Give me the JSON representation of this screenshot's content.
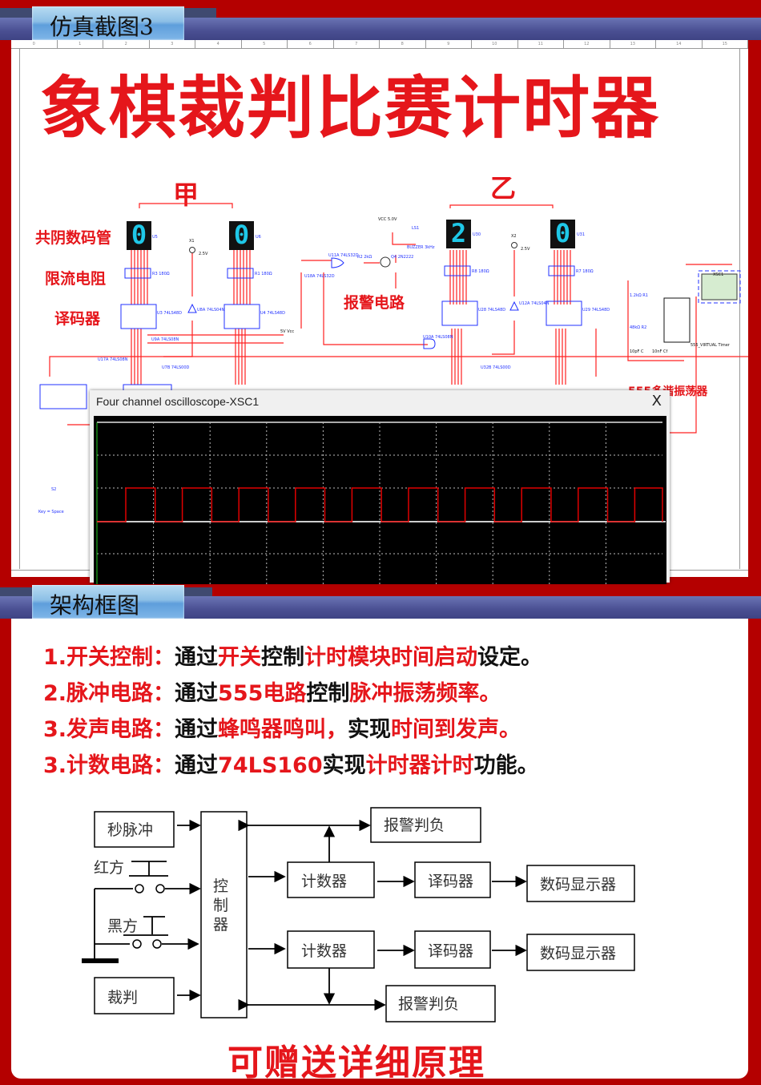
{
  "section1": {
    "tab": "仿真截图3"
  },
  "schematic": {
    "title": "象棋裁判比赛计时器",
    "player_a": "甲",
    "player_b": "乙",
    "labels": {
      "display": "共阴数码管",
      "resistor": "限流电阻",
      "decoder": "译码器",
      "alarm": "报警电路",
      "oscillator": "555多谐振荡器"
    },
    "displays": [
      {
        "ref": "U5",
        "digit": "0"
      },
      {
        "ref": "U6",
        "digit": "0"
      },
      {
        "ref": "U30",
        "digit": "2"
      },
      {
        "ref": "U31",
        "digit": "0"
      }
    ],
    "components": {
      "r3": "R3 180Ω",
      "r1": "R1 180Ω",
      "r8": "R8 180Ω",
      "r7": "R7 180Ω",
      "u3": "U3 74LS48D",
      "u4": "U4 74LS48D",
      "u28": "U28 74LS48D",
      "u29": "U29 74LS48D",
      "u8a": "U8A 74LS04N",
      "u12a": "U12A 74LS04N",
      "x1": "X1",
      "x2": "X2",
      "v25": "2.5V",
      "u11a": "U11A 74LS32D",
      "u18a": "U18A 74LS32D",
      "r2": "R2 2kΩ",
      "q4": "Q4 2N2222",
      "vcc": "VCC 5.0V",
      "ls1": "LS1",
      "buzzer": "BUZZER 3kHz",
      "u9a": "U9A 74LS08N",
      "u17a": "U17A 74LS08N",
      "u7b": "U7B 74LS00D",
      "u10a": "U10A 74LS08N",
      "u32b": "U32B 74LS00D",
      "vcc5": "5V Vcc",
      "timer": "555_VIRTUAL Timer",
      "xsc1": "XSC1",
      "c": "10pF C",
      "cf": "10nF Cf",
      "r1b": "1.2kΩ R1",
      "r2b": "48kΩ R2",
      "s2": "S2",
      "key": "Key = Space"
    }
  },
  "oscilloscope": {
    "title": "Four channel oscilloscope-XSC1",
    "close_label": "X",
    "trace_color": "#e00000",
    "signal": "square wave",
    "duty_cycle": 0.52
  },
  "section2": {
    "tab": "架构框图"
  },
  "description": [
    [
      {
        "t": "1.开关控制：",
        "c": "#e5161b"
      },
      {
        "t": "通过",
        "c": "#111"
      },
      {
        "t": "开关",
        "c": "#e5161b"
      },
      {
        "t": "控制",
        "c": "#111"
      },
      {
        "t": "计时模块时间启动",
        "c": "#e5161b"
      },
      {
        "t": "设定。",
        "c": "#111"
      }
    ],
    [
      {
        "t": "2.脉冲电路：",
        "c": "#e5161b"
      },
      {
        "t": "通过",
        "c": "#111"
      },
      {
        "t": "555电路",
        "c": "#e5161b"
      },
      {
        "t": "控制",
        "c": "#111"
      },
      {
        "t": "脉冲振荡频率。",
        "c": "#e5161b"
      }
    ],
    [
      {
        "t": "3.发声电路：",
        "c": "#e5161b"
      },
      {
        "t": "通过",
        "c": "#111"
      },
      {
        "t": "蜂鸣器鸣叫，",
        "c": "#e5161b"
      },
      {
        "t": "实现",
        "c": "#111"
      },
      {
        "t": "时间到发声。",
        "c": "#e5161b"
      }
    ],
    [
      {
        "t": "3.计数电路：",
        "c": "#e5161b"
      },
      {
        "t": "通过",
        "c": "#111"
      },
      {
        "t": "74LS160",
        "c": "#e5161b"
      },
      {
        "t": "实现",
        "c": "#111"
      },
      {
        "t": "计时器计时",
        "c": "#e5161b"
      },
      {
        "t": "功能。",
        "c": "#111"
      }
    ]
  ],
  "block_diagram": {
    "second_pulse": "秒脉冲",
    "red_side": "红方",
    "black_side": "黑方",
    "referee": "裁判",
    "controller": [
      "控",
      "制",
      "器"
    ],
    "alarm_top": "报警判负",
    "alarm_bottom": "报警判负",
    "counter": "计数器",
    "decoder": "译码器",
    "display": "数码显示器"
  },
  "footer": "可赠送详细原理",
  "colors": {
    "background": "#b40000",
    "accent_red": "#e5161b",
    "segment": "#1fc8e8",
    "wire": "#ff2020",
    "chip": "#2030ff"
  }
}
